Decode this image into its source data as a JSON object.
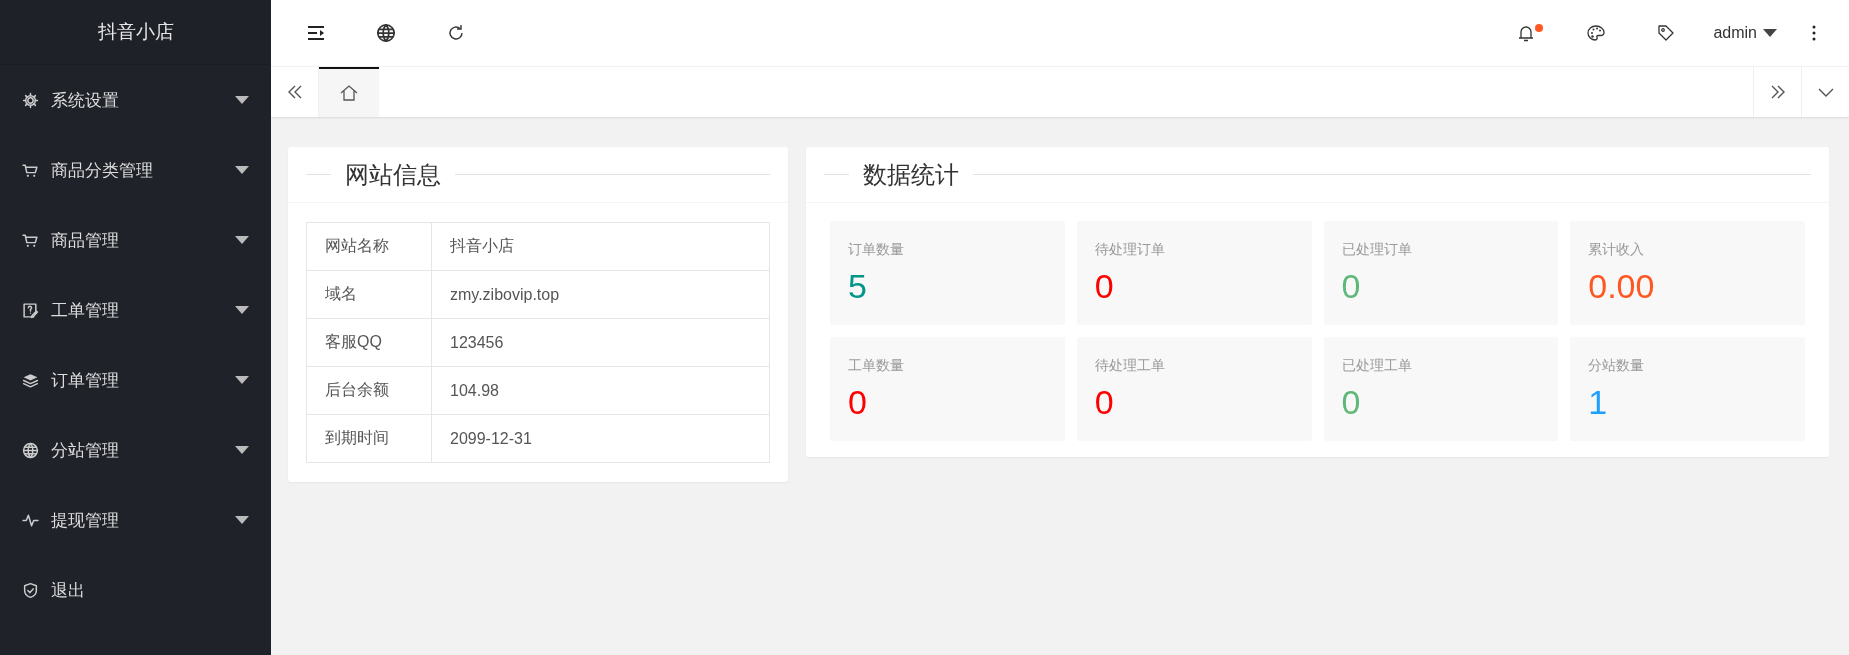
{
  "sidebar": {
    "title": "抖音小店",
    "items": [
      {
        "label": "系统设置",
        "expandable": true
      },
      {
        "label": "商品分类管理",
        "expandable": true
      },
      {
        "label": "商品管理",
        "expandable": true
      },
      {
        "label": "工单管理",
        "expandable": true
      },
      {
        "label": "订单管理",
        "expandable": true
      },
      {
        "label": "分站管理",
        "expandable": true
      },
      {
        "label": "提现管理",
        "expandable": true
      },
      {
        "label": "退出",
        "expandable": false
      }
    ]
  },
  "header": {
    "notifications_unread": true,
    "user": "admin"
  },
  "tabs": [
    {
      "selected": true
    }
  ],
  "site_info": {
    "title": "网站信息",
    "rows": [
      {
        "label": "网站名称",
        "value": "抖音小店"
      },
      {
        "label": "域名",
        "value": "zmy.zibovip.top"
      },
      {
        "label": "客服QQ",
        "value": "123456"
      },
      {
        "label": "后台余额",
        "value": "104.98"
      },
      {
        "label": "到期时间",
        "value": "2099-12-31"
      }
    ]
  },
  "stats": {
    "title": "数据统计",
    "items": [
      {
        "label": "订单数量",
        "value": "5",
        "color": "#009688"
      },
      {
        "label": "待处理订单",
        "value": "0",
        "color": "#ff0000"
      },
      {
        "label": "已处理订单",
        "value": "0",
        "color": "#5fb878"
      },
      {
        "label": "累计收入",
        "value": "0.00",
        "color": "#ff5722"
      },
      {
        "label": "工单数量",
        "value": "0",
        "color": "#ff0000"
      },
      {
        "label": "待处理工单",
        "value": "0",
        "color": "#ff0000"
      },
      {
        "label": "已处理工单",
        "value": "0",
        "color": "#5fb878"
      },
      {
        "label": "分站数量",
        "value": "1",
        "color": "#1e9fff"
      }
    ]
  }
}
